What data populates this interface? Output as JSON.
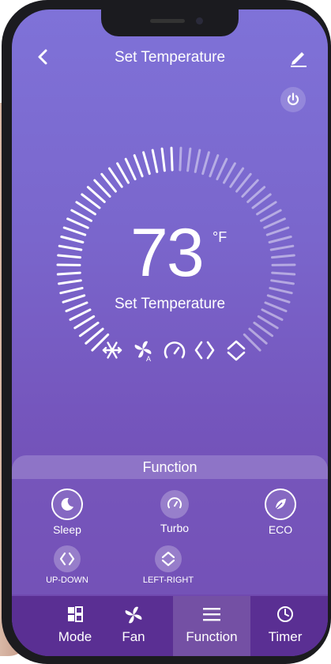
{
  "header": {
    "title": "Set Temperature"
  },
  "thermostat": {
    "temperature": "73",
    "unit": "°F",
    "label": "Set Temperature",
    "active_fraction": 0.5
  },
  "status_icons": [
    "snowflake-icon",
    "fan-auto-icon",
    "turbo-gauge-icon",
    "swing-updown-icon",
    "swing-leftright-icon"
  ],
  "function_panel": {
    "title": "Function",
    "items": [
      {
        "label": "Sleep",
        "icon": "moon-icon"
      },
      {
        "label": "Turbo",
        "icon": "gauge-icon"
      },
      {
        "label": "ECO",
        "icon": "leaf-icon"
      },
      {
        "label": "UP-DOWN",
        "icon": "swing-updown-icon"
      },
      {
        "label": "LEFT-RIGHT",
        "icon": "swing-leftright-icon"
      }
    ]
  },
  "tabs": [
    {
      "label": "Mode",
      "icon": "mode-icon"
    },
    {
      "label": "Fan",
      "icon": "fan-icon"
    },
    {
      "label": "Function",
      "icon": "menu-icon",
      "active": true
    },
    {
      "label": "Timer",
      "icon": "clock-icon"
    }
  ],
  "colors": {
    "accent": "#7a66cc",
    "tabbar": "#5a2f93"
  }
}
